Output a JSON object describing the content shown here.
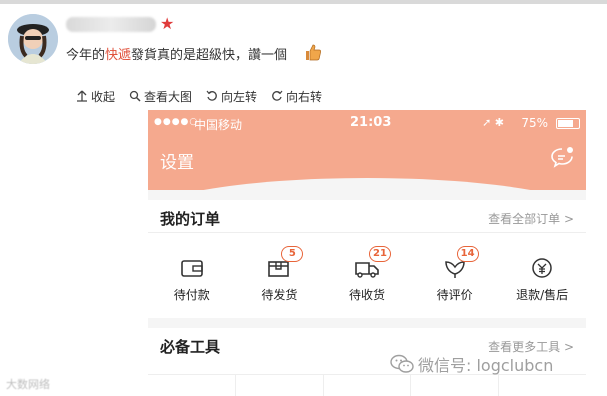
{
  "post": {
    "username_blurred": "",
    "text_before": "今年的",
    "text_highlight": "快遞",
    "text_after": "發貨真的是超級快，讚一個"
  },
  "toolbar": {
    "collapse": "收起",
    "view_large": "查看大图",
    "rotate_left": "向左转",
    "rotate_right": "向右转"
  },
  "phone": {
    "status": {
      "carrier": "中国移动",
      "time": "21:03",
      "battery": "75%"
    },
    "title": "设置",
    "orders": {
      "title": "我的订单",
      "link": "查看全部订单 >",
      "items": [
        {
          "label": "待付款",
          "icon": "wallet-icon",
          "badge": ""
        },
        {
          "label": "待发货",
          "icon": "package-icon",
          "badge": "5"
        },
        {
          "label": "待收货",
          "icon": "truck-icon",
          "badge": "21"
        },
        {
          "label": "待评价",
          "icon": "flower-icon",
          "badge": "14"
        },
        {
          "label": "退款/售后",
          "icon": "refund-icon",
          "badge": ""
        }
      ]
    },
    "tools": {
      "title": "必备工具",
      "link": "查看更多工具 >"
    }
  },
  "watermark": {
    "text": "微信号: logclubcn",
    "left_text": "大数网络"
  },
  "colors": {
    "header": "#f5a98e",
    "badge": "#e8653a",
    "highlight": "#e0503a"
  }
}
